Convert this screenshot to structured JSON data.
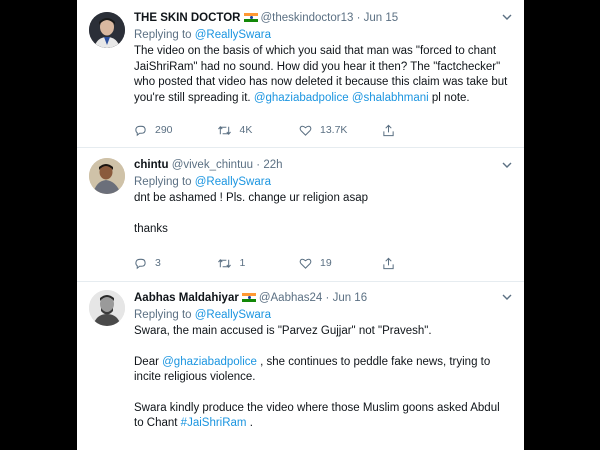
{
  "tweets": [
    {
      "name": "THE SKIN DOCTOR",
      "handle": "@theskindoctor13",
      "separator": "·",
      "time": "Jun 15",
      "replying_prefix": "Replying to",
      "replying_to": "@ReallySwara",
      "text_before": "The video on the basis of which you said that man was \"forced to chant JaiShriRam\" had no sound. How did you hear it then? The \"factchecker\" who posted that video has now deleted it because this claim was take but you're still spreading it. ",
      "mention1": "@ghaziabadpolice",
      "space": " ",
      "mention2": "@shalabhmani",
      "text_after": " pl note.",
      "replies": "290",
      "retweets": "4K",
      "likes": "13.7K"
    },
    {
      "name": "chintu",
      "handle": "@vivek_chintuu",
      "separator": "·",
      "time": "22h",
      "replying_prefix": "Replying to",
      "replying_to": "@ReallySwara",
      "line1": "dnt be ashamed ! Pls. change ur religion asap",
      "line2": "thanks",
      "replies": "3",
      "retweets": "1",
      "likes": "19"
    },
    {
      "name": "Aabhas Maldahiyar",
      "handle": "@Aabhas24",
      "separator": "·",
      "time": "Jun 16",
      "replying_prefix": "Replying to",
      "replying_to": "@ReallySwara",
      "para1": "Swara, the main accused is \"Parvez Gujjar\" not \"Pravesh\".",
      "para2_prefix": "Dear ",
      "para2_mention": "@ghaziabadpolice",
      "para2_text": " , she continues to peddle fake news, trying to incite religious violence.",
      "para3_text": "Swara kindly produce the video where those Muslim goons asked Abdul to Chant ",
      "para3_hashtag": "#JaiShriRam",
      "para3_end": " ."
    }
  ],
  "icons": {
    "reply": "reply-icon",
    "retweet": "retweet-icon",
    "like": "like-icon",
    "share": "share-icon",
    "more": "chevron-down-icon",
    "flag": "india-flag-icon"
  },
  "colors": {
    "link": "#1b95e0",
    "secondary": "#5b7083",
    "text": "#0f1419",
    "border": "#e6ecf0",
    "background": "#000000"
  }
}
